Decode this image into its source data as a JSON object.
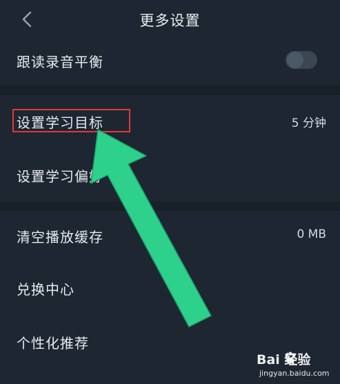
{
  "header": {
    "title": "更多设置"
  },
  "settings": {
    "reading_balance": {
      "label": "跟读录音平衡",
      "toggle_on": false
    },
    "study_goal": {
      "label": "设置学习目标",
      "value": "5 分钟"
    },
    "study_preference": {
      "label": "设置学习偏好"
    },
    "clear_cache": {
      "label": "清空播放缓存",
      "value": "0 MB"
    },
    "redeem_center": {
      "label": "兑换中心"
    },
    "personalized_rec": {
      "label": "个性化推荐"
    }
  },
  "annotation": {
    "highlight_color": "#e23a3a",
    "arrow_color": "#2ed18b"
  },
  "watermark": {
    "logo": "Bai 经验",
    "url": "jingyan.baidu.com"
  }
}
